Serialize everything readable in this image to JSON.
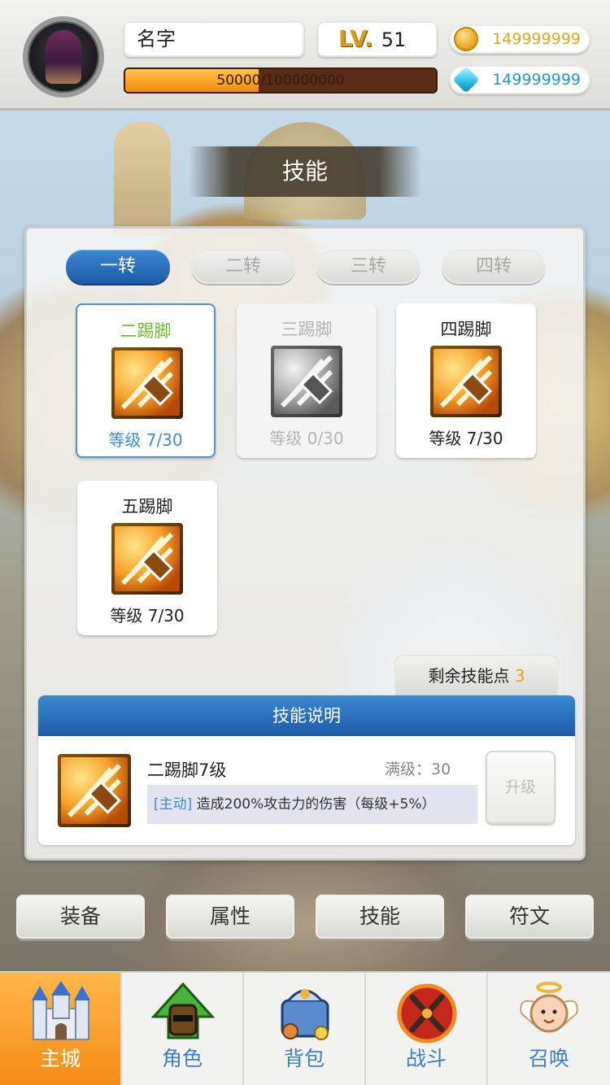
{
  "header": {
    "name": "名字",
    "level_prefix": "LV.",
    "level": "51",
    "xp_text": "50000/100000000",
    "xp_progress": 0.43,
    "gold": "149999999",
    "gems": "149999999"
  },
  "title": "技能",
  "tabs": [
    "一转",
    "二转",
    "三转",
    "四转"
  ],
  "skills": [
    {
      "name": "二踢脚",
      "level": "等级 7/30"
    },
    {
      "name": "三踢脚",
      "level": "等级 0/30"
    },
    {
      "name": "四踢脚",
      "level": "等级 7/30"
    },
    {
      "name": "五踢脚",
      "level": "等级 7/30"
    }
  ],
  "points": {
    "label": "剩余技能点",
    "value": "3"
  },
  "description": {
    "header": "技能说明",
    "skill_name": "二踢脚7级",
    "max_level": "满级：30",
    "tag": "[主动]",
    "effect": "造成200%攻击力的伤害（每级+5%）",
    "upgrade": "升级"
  },
  "bottom_buttons": [
    "装备",
    "属性",
    "技能",
    "符文"
  ],
  "nav": [
    {
      "label": "主城",
      "icon": "castle-icon"
    },
    {
      "label": "角色",
      "icon": "helmet-icon"
    },
    {
      "label": "背包",
      "icon": "backpack-icon"
    },
    {
      "label": "战斗",
      "icon": "battle-icon"
    },
    {
      "label": "召唤",
      "icon": "angel-icon"
    }
  ],
  "colors": {
    "accent": "#2a70bf",
    "nav_active": "#f68a14",
    "gold": "#e8a21d",
    "gem": "#1d9ad2",
    "selected_name": "#69c12b"
  }
}
